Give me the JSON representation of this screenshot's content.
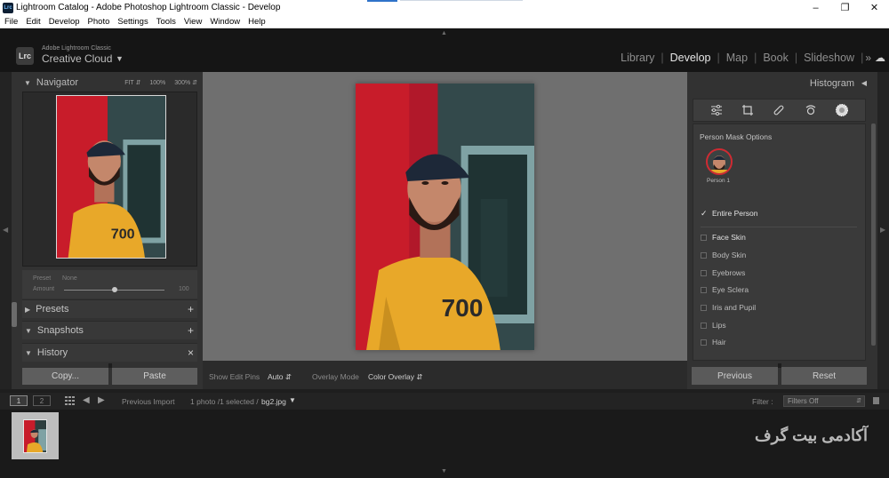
{
  "window": {
    "title": "Lightroom Catalog - Adobe Photoshop Lightroom Classic - Develop",
    "controls": [
      "minimize-icon",
      "maximize-icon",
      "close-icon"
    ]
  },
  "menu": [
    "File",
    "Edit",
    "Develop",
    "Photo",
    "Settings",
    "Tools",
    "View",
    "Window",
    "Help"
  ],
  "identity": {
    "logo": "Lrc",
    "small": "Adobe Lightroom Classic",
    "large": "Creative Cloud"
  },
  "modules": [
    "Library",
    "Develop",
    "Map",
    "Book",
    "Slideshow"
  ],
  "active_module": "Develop",
  "left_panel": {
    "navigator": {
      "title": "Navigator",
      "zoom": [
        "FIT",
        "100%",
        "300%"
      ]
    },
    "preset": {
      "label": "Preset",
      "value": "None",
      "amount_label": "Amount",
      "amount_value": "100"
    },
    "sections": [
      "Presets",
      "Snapshots",
      "History"
    ],
    "copy_label": "Copy...",
    "paste_label": "Paste"
  },
  "toolbar": {
    "pins_label": "Show Edit Pins",
    "pins_value": "Auto",
    "overlay_label": "Overlay Mode",
    "overlay_value": "Color Overlay"
  },
  "right_panel": {
    "histogram_title": "Histogram",
    "tools": [
      "sliders-icon",
      "crop-icon",
      "healing-icon",
      "red-eye-icon",
      "masking-icon"
    ],
    "mask_title": "Person Mask Options",
    "person_label": "Person 1",
    "entire_person": "Entire Person",
    "options": [
      "Face Skin",
      "Body Skin",
      "Eyebrows",
      "Eye Sclera",
      "Iris and Pupil",
      "Lips",
      "Hair"
    ],
    "previous_label": "Previous",
    "reset_label": "Reset"
  },
  "filmstrip": {
    "screen1": "1",
    "screen2": "2",
    "source": "Previous Import",
    "count": "1 photo /1 selected /",
    "file": "bg2.jpg",
    "filter_label": "Filter :",
    "filter_value": "Filters Off"
  },
  "watermark": "آکادمی بیت گرف",
  "colors": {
    "accent_red": "#d02a32",
    "shirt_yellow": "#e8a829",
    "panel_bg": "#323232"
  }
}
